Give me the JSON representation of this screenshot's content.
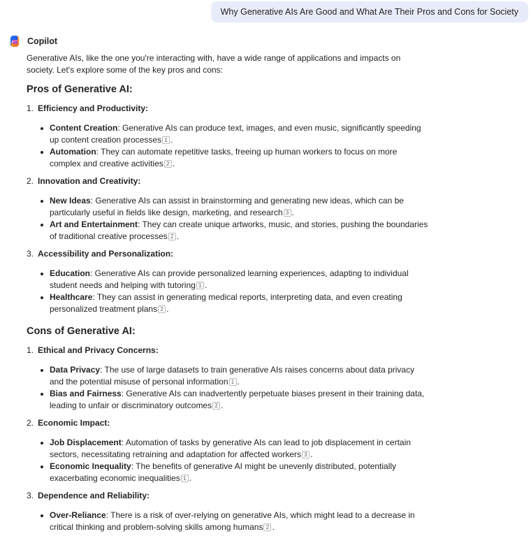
{
  "user_message": "Why Generative AIs Are Good and What Are Their Pros and Cons for Society",
  "assistant": {
    "name": "Copilot",
    "intro": "Generative AIs, like the one you're interacting with, have a wide range of applications and impacts on society. Let's explore some of the key pros and cons:",
    "pros_heading": "Pros of Generative AI:",
    "cons_heading": "Cons of Generative AI:",
    "pros": [
      {
        "num": "1.",
        "title": "Efficiency and Productivity:",
        "items": [
          {
            "term": "Content Creation",
            "text": ": Generative AIs can produce text, images, and even music, significantly speeding up content creation processes",
            "cite": "1"
          },
          {
            "term": "Automation",
            "text": ": They can automate repetitive tasks, freeing up human workers to focus on more complex and creative activities",
            "cite": "2"
          }
        ]
      },
      {
        "num": "2.",
        "title": "Innovation and Creativity:",
        "items": [
          {
            "term": "New Ideas",
            "text": ": Generative AIs can assist in brainstorming and generating new ideas, which can be particularly useful in fields like design, marketing, and research",
            "cite": "3"
          },
          {
            "term": "Art and Entertainment",
            "text": ": They can create unique artworks, music, and stories, pushing the boundaries of traditional creative processes",
            "cite": "2"
          }
        ]
      },
      {
        "num": "3.",
        "title": "Accessibility and Personalization:",
        "items": [
          {
            "term": "Education",
            "text": ": Generative AIs can provide personalized learning experiences, adapting to individual student needs and helping with tutoring",
            "cite": "1"
          },
          {
            "term": "Healthcare",
            "text": ": They can assist in generating medical reports, interpreting data, and even creating personalized treatment plans",
            "cite": "2"
          }
        ]
      }
    ],
    "cons": [
      {
        "num": "1.",
        "title": "Ethical and Privacy Concerns:",
        "items": [
          {
            "term": "Data Privacy",
            "text": ": The use of large datasets to train generative AIs raises concerns about data privacy and the potential misuse of personal information",
            "cite": "1"
          },
          {
            "term": "Bias and Fairness",
            "text": ": Generative AIs can inadvertently perpetuate biases present in their training data, leading to unfair or discriminatory outcomes",
            "cite": "2"
          }
        ]
      },
      {
        "num": "2.",
        "title": "Economic Impact:",
        "items": [
          {
            "term": "Job Displacement",
            "text": ": Automation of tasks by generative AIs can lead to job displacement in certain sectors, necessitating retraining and adaptation for affected workers",
            "cite": "3"
          },
          {
            "term": "Economic Inequality",
            "text": ": The benefits of generative AI might be unevenly distributed, potentially exacerbating economic inequalities",
            "cite": "1"
          }
        ]
      },
      {
        "num": "3.",
        "title": "Dependence and Reliability:",
        "items": [
          {
            "term": "Over-Reliance",
            "text": ": There is a risk of over-relying on generative AIs, which might lead to a decrease in critical thinking and problem-solving skills among humans",
            "cite": "2"
          }
        ]
      }
    ]
  },
  "icons": {
    "assistant_logo": "copilot-logo-icon"
  },
  "colors": {
    "user_bubble_bg": "#e8ebfa",
    "text": "#242424"
  }
}
